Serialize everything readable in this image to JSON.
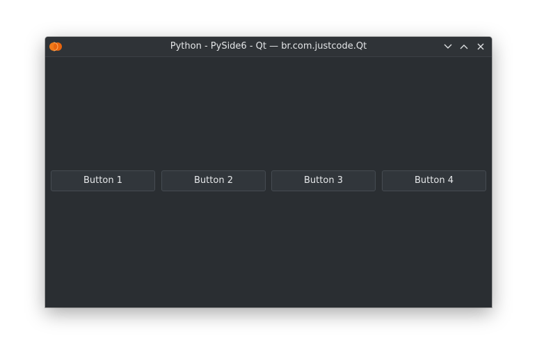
{
  "window": {
    "title": "Python - PySide6 - Qt — br.com.justcode.Qt",
    "icon": "python-app-icon",
    "controls": {
      "minimize_icon": "chevron-down-icon",
      "maximize_icon": "chevron-up-icon",
      "close_icon": "close-icon"
    }
  },
  "buttons": [
    {
      "label": "Button 1"
    },
    {
      "label": "Button 2"
    },
    {
      "label": "Button 3"
    },
    {
      "label": "Button 4"
    }
  ],
  "colors": {
    "window_bg": "#2a2e32",
    "titlebar_bg": "#2f3337",
    "button_bg": "#31363b",
    "button_border": "#464c52",
    "text": "#e6e8ea",
    "icon_accent": "#f07a1a"
  }
}
